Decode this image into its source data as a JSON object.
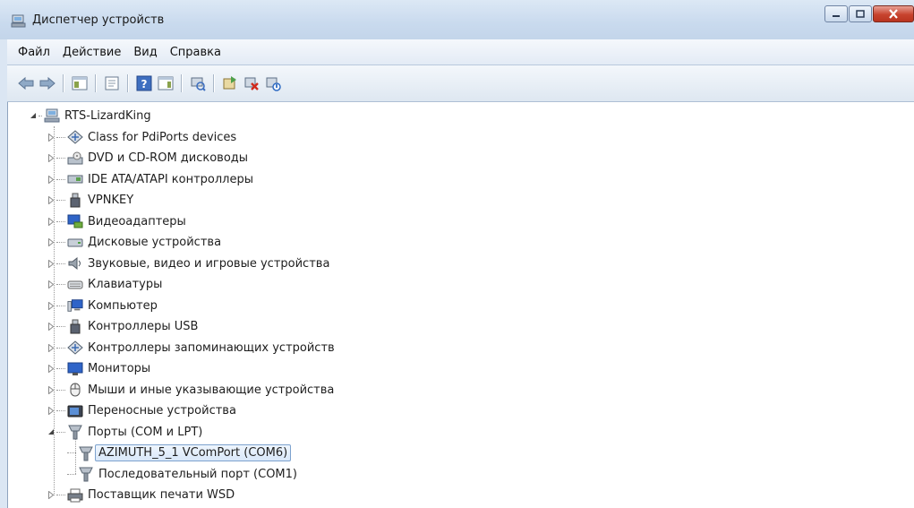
{
  "window": {
    "title": "Диспетчер устройств"
  },
  "menu": {
    "items": [
      "Файл",
      "Действие",
      "Вид",
      "Справка"
    ]
  },
  "toolbar": {
    "buttons": [
      "back-arrow-icon",
      "forward-arrow-icon",
      "console-tree-icon",
      "properties-icon",
      "help-icon",
      "action-pane-icon",
      "scan-hardware-icon",
      "update-driver-icon",
      "uninstall-device-icon",
      "disable-device-icon"
    ]
  },
  "tree": {
    "root": "RTS-LizardKing",
    "items": [
      {
        "label": "Class for PdiPorts devices",
        "icon": "diamond-arrows-icon",
        "expanded": false
      },
      {
        "label": "DVD и CD-ROM дисководы",
        "icon": "optical-drive-icon",
        "expanded": false
      },
      {
        "label": "IDE ATA/ATAPI контроллеры",
        "icon": "ide-controller-icon",
        "expanded": false
      },
      {
        "label": "VPNKEY",
        "icon": "usb-plug-icon",
        "expanded": false
      },
      {
        "label": "Видеоадаптеры",
        "icon": "display-adapter-icon",
        "expanded": false
      },
      {
        "label": "Дисковые устройства",
        "icon": "disk-drive-icon",
        "expanded": false
      },
      {
        "label": "Звуковые, видео и игровые устройства",
        "icon": "speaker-icon",
        "expanded": false
      },
      {
        "label": "Клавиатуры",
        "icon": "keyboard-icon",
        "expanded": false
      },
      {
        "label": "Компьютер",
        "icon": "computer-icon",
        "expanded": false
      },
      {
        "label": "Контроллеры USB",
        "icon": "usb-plug-icon",
        "expanded": false
      },
      {
        "label": "Контроллеры запоминающих устройств",
        "icon": "diamond-arrows-icon",
        "expanded": false
      },
      {
        "label": "Мониторы",
        "icon": "monitor-icon",
        "expanded": false
      },
      {
        "label": "Мыши и иные указывающие устройства",
        "icon": "mouse-icon",
        "expanded": false
      },
      {
        "label": "Переносные устройства",
        "icon": "portable-device-icon",
        "expanded": false
      },
      {
        "label": "Порты (COM и LPT)",
        "icon": "port-icon",
        "expanded": true
      },
      {
        "label": "Поставщик печати WSD",
        "icon": "printer-icon",
        "expanded": false
      }
    ],
    "port_children": [
      {
        "label": "AZIMUTH_5_1 VComPort (COM6)",
        "icon": "port-icon",
        "selected": true
      },
      {
        "label": "Последовательный порт (COM1)",
        "icon": "port-icon",
        "selected": false
      }
    ]
  }
}
